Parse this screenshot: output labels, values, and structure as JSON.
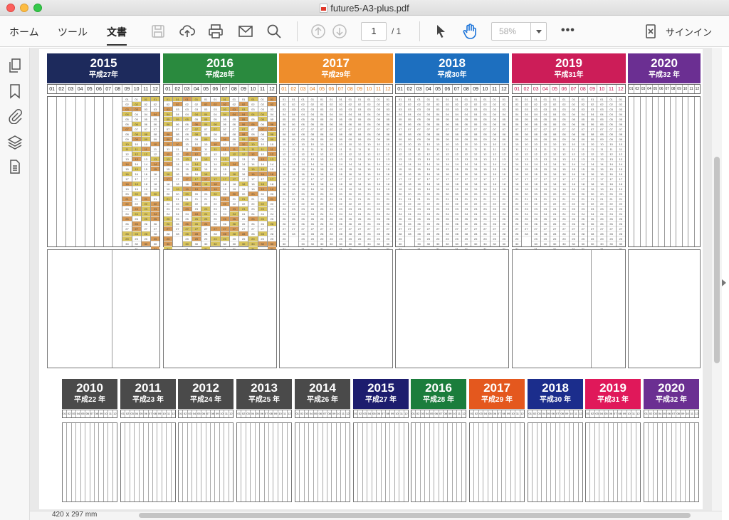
{
  "window": {
    "title": "future5-A3-plus.pdf"
  },
  "toolbar": {
    "tabs": [
      "ホーム",
      "ツール",
      "文書"
    ],
    "active_tab": "文書",
    "page_current": "1",
    "page_total": "/ 1",
    "zoom": "58%",
    "more": "•••",
    "signin": "サインイン"
  },
  "status": {
    "page_size": "420 x 297 mm"
  },
  "calendar_top": {
    "years": [
      {
        "year": "2015",
        "era": "平成27年",
        "color": "#1d2a5c"
      },
      {
        "year": "2016",
        "era": "平成28年",
        "color": "#2a8a3e"
      },
      {
        "year": "2017",
        "era": "平成29年",
        "color": "#ee8d2b"
      },
      {
        "year": "2018",
        "era": "平成30年",
        "color": "#1d6fbf"
      },
      {
        "year": "2019",
        "era": "平成31年",
        "color": "#cc1d58"
      },
      {
        "year": "2020",
        "era": "平成32 年",
        "color": "#6b2f92"
      }
    ],
    "months": [
      "01",
      "02",
      "03",
      "04",
      "05",
      "06",
      "07",
      "08",
      "09",
      "10",
      "11",
      "12"
    ]
  },
  "calendar_bottom": {
    "years": [
      {
        "year": "2010",
        "era": "平成22 年",
        "color": "#4a4a4a"
      },
      {
        "year": "2011",
        "era": "平成23 年",
        "color": "#4a4a4a"
      },
      {
        "year": "2012",
        "era": "平成24 年",
        "color": "#4a4a4a"
      },
      {
        "year": "2013",
        "era": "平成25 年",
        "color": "#4a4a4a"
      },
      {
        "year": "2014",
        "era": "平成26 年",
        "color": "#4a4a4a"
      },
      {
        "year": "2015",
        "era": "平成27 年",
        "color": "#1d1d6e"
      },
      {
        "year": "2016",
        "era": "平成28 年",
        "color": "#1b7d3c"
      },
      {
        "year": "2017",
        "era": "平成29 年",
        "color": "#e4581e"
      },
      {
        "year": "2018",
        "era": "平成30 年",
        "color": "#1b2d8c"
      },
      {
        "year": "2019",
        "era": "平成31 年",
        "color": "#e0185a"
      },
      {
        "year": "2020",
        "era": "平成32 年",
        "color": "#6b2f92"
      }
    ]
  }
}
